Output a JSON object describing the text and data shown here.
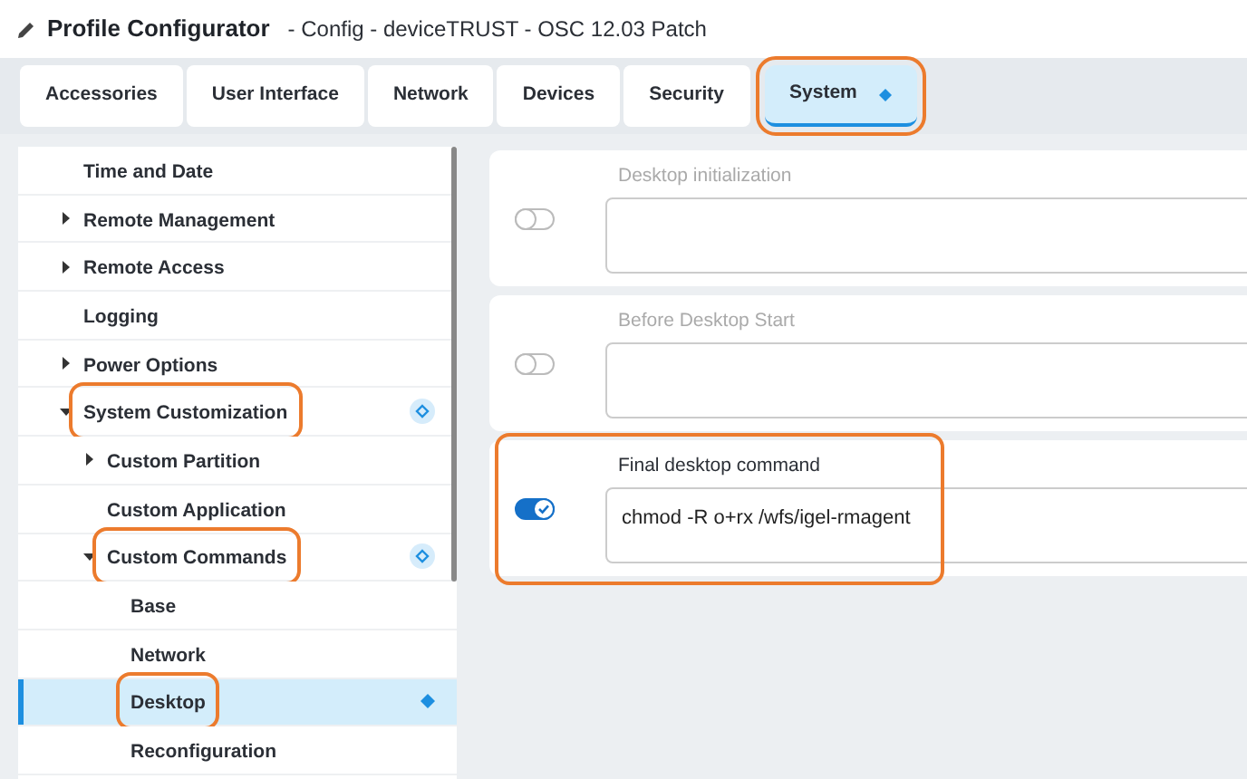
{
  "header": {
    "title": "Profile Configurator",
    "subtitle": "- Config - deviceTRUST - OSC 12.03 Patch"
  },
  "tabs": [
    {
      "label": "Accessories",
      "selected": false,
      "changed": false,
      "highlighted": false
    },
    {
      "label": "User Interface",
      "selected": false,
      "changed": false,
      "highlighted": false
    },
    {
      "label": "Network",
      "selected": false,
      "changed": false,
      "highlighted": false
    },
    {
      "label": "Devices",
      "selected": false,
      "changed": false,
      "highlighted": false
    },
    {
      "label": "Security",
      "selected": false,
      "changed": false,
      "highlighted": false
    },
    {
      "label": "System",
      "selected": true,
      "changed": true,
      "highlighted": true
    }
  ],
  "tree": [
    {
      "label": "Time and Date",
      "has_children": false,
      "selected": false,
      "changed": false,
      "child_changed": false,
      "highlighted": false
    },
    {
      "label": "Remote Management",
      "has_children": true,
      "expanded": false,
      "selected": false,
      "changed": false,
      "child_changed": false,
      "highlighted": false
    },
    {
      "label": "Remote Access",
      "has_children": true,
      "expanded": false,
      "selected": false,
      "changed": false,
      "child_changed": false,
      "highlighted": false
    },
    {
      "label": "Logging",
      "has_children": false,
      "selected": false,
      "changed": false,
      "child_changed": false,
      "highlighted": false
    },
    {
      "label": "Power Options",
      "has_children": true,
      "expanded": false,
      "selected": false,
      "changed": false,
      "child_changed": false,
      "highlighted": false
    },
    {
      "label": "System Customization",
      "has_children": true,
      "expanded": true,
      "selected": false,
      "changed": false,
      "child_changed": true,
      "highlighted": true,
      "children": [
        {
          "label": "Custom Partition",
          "has_children": true,
          "expanded": false,
          "selected": false,
          "changed": false,
          "child_changed": false,
          "highlighted": false
        },
        {
          "label": "Custom Application",
          "has_children": false,
          "selected": false,
          "changed": false,
          "child_changed": false,
          "highlighted": false
        },
        {
          "label": "Custom Commands",
          "has_children": true,
          "expanded": true,
          "selected": false,
          "changed": false,
          "child_changed": true,
          "highlighted": true,
          "children": [
            {
              "label": "Base",
              "has_children": false,
              "selected": false,
              "changed": false,
              "child_changed": false,
              "highlighted": false
            },
            {
              "label": "Network",
              "has_children": false,
              "selected": false,
              "changed": false,
              "child_changed": false,
              "highlighted": false
            },
            {
              "label": "Desktop",
              "has_children": false,
              "selected": true,
              "changed": true,
              "child_changed": false,
              "highlighted": true
            },
            {
              "label": "Reconfiguration",
              "has_children": false,
              "selected": false,
              "changed": false,
              "child_changed": false,
              "highlighted": false
            }
          ]
        }
      ]
    }
  ],
  "commands": [
    {
      "label": "Desktop initialization",
      "on": false,
      "highlighted": false
    },
    {
      "label": "Before Desktop Start",
      "on": false,
      "highlighted": false
    },
    {
      "label": "Final desktop command",
      "on": true,
      "value": "chmod -R o+rx /wfs/igel-rmagent",
      "highlighted": true
    }
  ]
}
